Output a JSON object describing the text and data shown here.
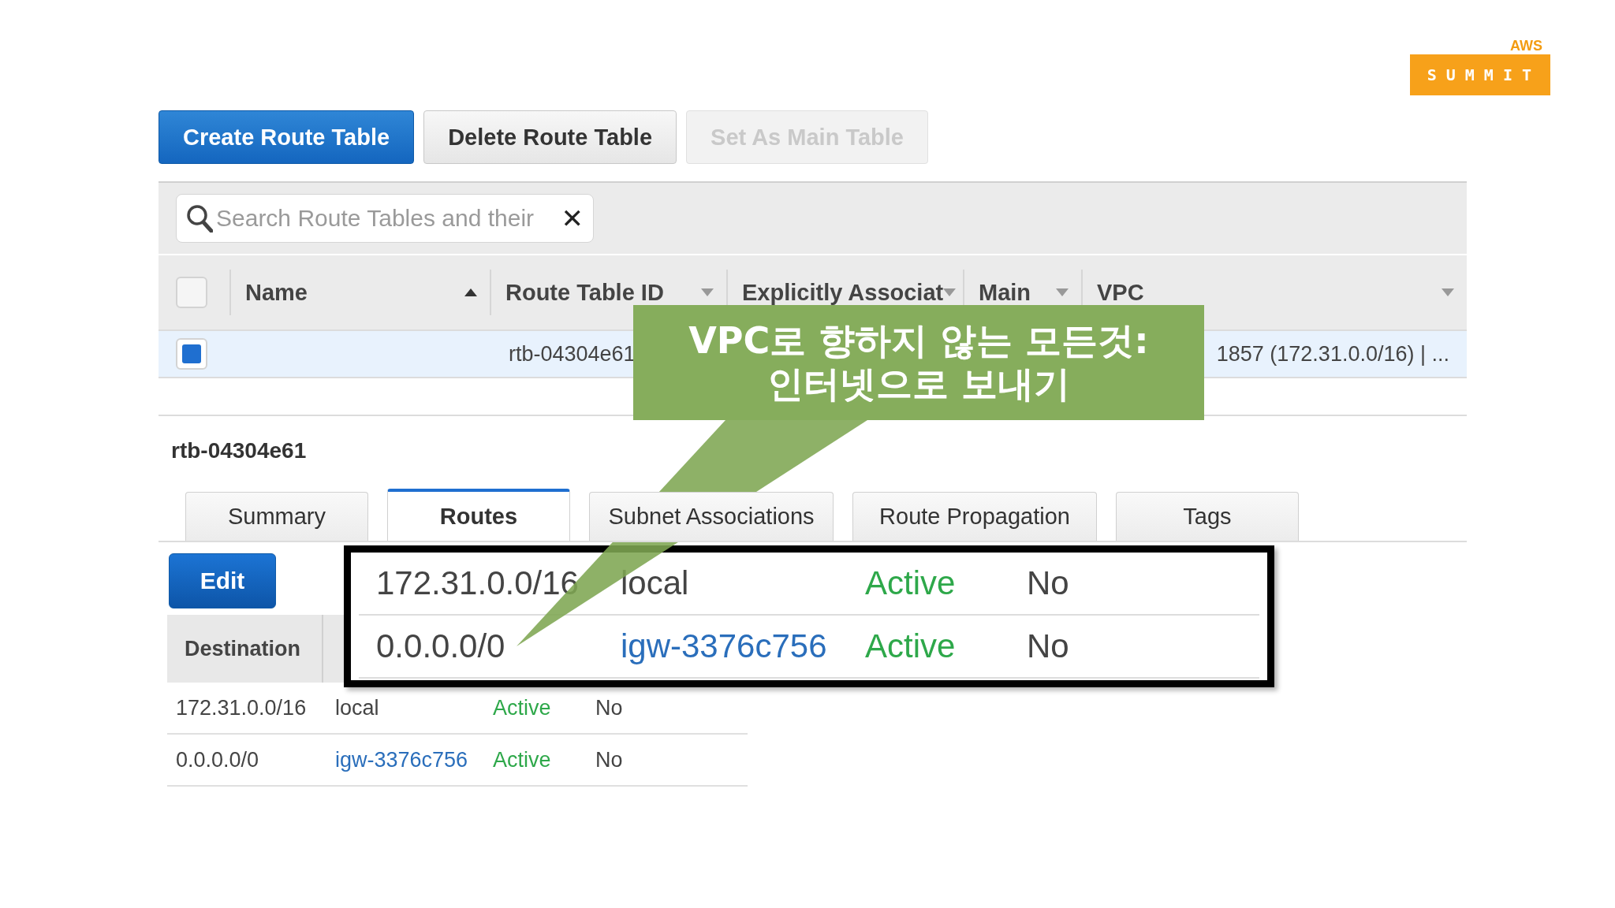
{
  "logo": {
    "top": "AWS",
    "badge": "SUMMIT"
  },
  "toolbar": {
    "buttons": [
      {
        "label": "Create Route Table",
        "kind": "primary",
        "disabled": false
      },
      {
        "label": "Delete Route Table",
        "kind": "secondary",
        "disabled": false
      },
      {
        "label": "Set As Main Table",
        "kind": "secondary",
        "disabled": true
      }
    ]
  },
  "search": {
    "placeholder": "Search Route Tables and their",
    "clear": "✕"
  },
  "table": {
    "select_all_checked": false,
    "columns": [
      {
        "label": "Name",
        "sorted": true
      },
      {
        "label": "Route Table ID",
        "sorted": false
      },
      {
        "label": "Explicitly Associat",
        "sorted": false
      },
      {
        "label": "Main",
        "sorted": false
      },
      {
        "label": "VPC",
        "sorted": false
      }
    ],
    "rows": [
      {
        "checked": true,
        "selected": true,
        "route_table_id": "rtb-04304e61",
        "vpc": "1857 (172.31.0.0/16) | ..."
      }
    ]
  },
  "detail": {
    "title": "rtb-04304e61",
    "tabs": [
      {
        "label": "Summary",
        "selected": false
      },
      {
        "label": "Routes",
        "selected": true
      },
      {
        "label": "Subnet Associations",
        "selected": false
      },
      {
        "label": "Route Propagation",
        "selected": false
      },
      {
        "label": "Tags",
        "selected": false
      }
    ],
    "edit_button": "Edit",
    "routes": {
      "columns": [
        "Destination"
      ],
      "rows": [
        {
          "destination": "172.31.0.0/16",
          "target": "local",
          "target_link": false,
          "status": "Active",
          "propagated": "No"
        },
        {
          "destination": "0.0.0.0/0",
          "target": "igw-3376c756",
          "target_link": true,
          "status": "Active",
          "propagated": "No"
        }
      ]
    }
  },
  "zoom": {
    "rows": [
      {
        "destination": "172.31.0.0/16",
        "target": "local",
        "target_link": false,
        "status": "Active",
        "propagated": "No"
      },
      {
        "destination": "0.0.0.0/0",
        "target": "igw-3376c756",
        "target_link": true,
        "status": "Active",
        "propagated": "No"
      }
    ]
  },
  "callout": {
    "lines": [
      "VPC로 향하지 않는 모든것:",
      "인터넷으로 보내기"
    ]
  }
}
